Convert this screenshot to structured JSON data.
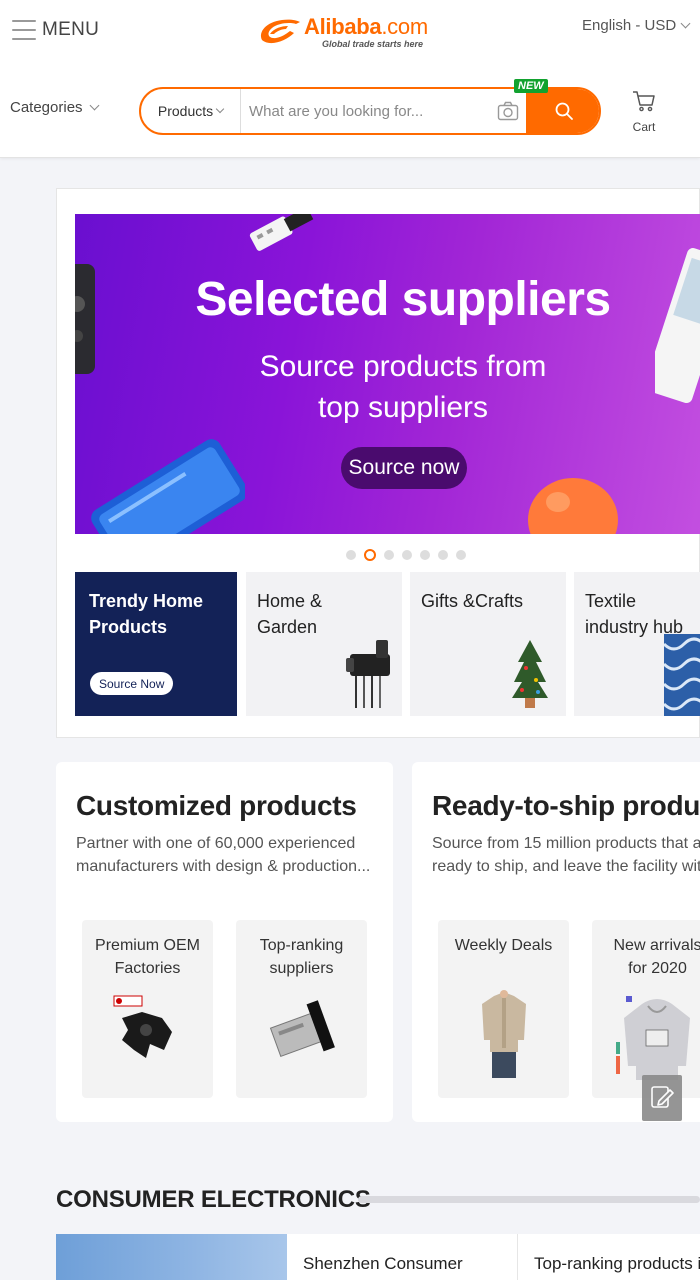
{
  "header": {
    "menu_label": "MENU",
    "logo_text": "Alibaba",
    "logo_suffix": ".com",
    "logo_tagline": "Global trade starts here",
    "language": "English - USD",
    "categories_label": "Categories",
    "search": {
      "scope": "Products",
      "placeholder": "What are you looking for...",
      "new_badge": "NEW"
    },
    "cart_label": "Cart"
  },
  "banner": {
    "title": "Selected suppliers",
    "subtitle_line1": "Source products from",
    "subtitle_line2": "top suppliers",
    "cta": "Source now",
    "slide_count": 7,
    "active_slide": 2,
    "colors": {
      "gradient_start": "#6a0fd0",
      "gradient_end": "#c34fe0",
      "cta_bg": "#4a0b6e"
    }
  },
  "tiles": [
    {
      "line1": "Trendy Home",
      "line2": "Products",
      "button": "Source Now",
      "icon": "none"
    },
    {
      "line1": "Home &",
      "line2": "Garden",
      "icon": "toothbrush-holder-icon"
    },
    {
      "line1": "Gifts &Crafts",
      "line2": "",
      "icon": "christmas-tree-icon"
    },
    {
      "line1": "Textile",
      "line2": "industry hub",
      "icon": "textile-fabric-icon"
    }
  ],
  "promos": [
    {
      "title": "Customized products",
      "desc_line1": "Partner with one of 60,000 experienced",
      "desc_line2": "manufacturers with design & production...",
      "cards": [
        {
          "line1": "Premium OEM",
          "line2": "Factories",
          "icon": "engine-part-icon"
        },
        {
          "line1": "Top-ranking",
          "line2": "suppliers",
          "icon": "car-stereo-icon"
        }
      ]
    },
    {
      "title": "Ready-to-ship produc",
      "desc_line1": "Source from 15 million products that a",
      "desc_line2": "ready to ship, and leave the facility wit",
      "cards": [
        {
          "line1": "Weekly Deals",
          "line2": "",
          "icon": "work-shirt-icon"
        },
        {
          "line1": "New arrivals",
          "line2": "for 2020",
          "icon": "hoodie-icon"
        }
      ]
    }
  ],
  "consumer_electronics": {
    "title": "CONSUMER ELECTRONICS",
    "item1": "Shenzhen Consumer",
    "item2": "Top-ranking products ir"
  },
  "colors": {
    "accent": "#ff6a00",
    "new_badge": "#12a22f",
    "dark_tile": "#132257"
  }
}
